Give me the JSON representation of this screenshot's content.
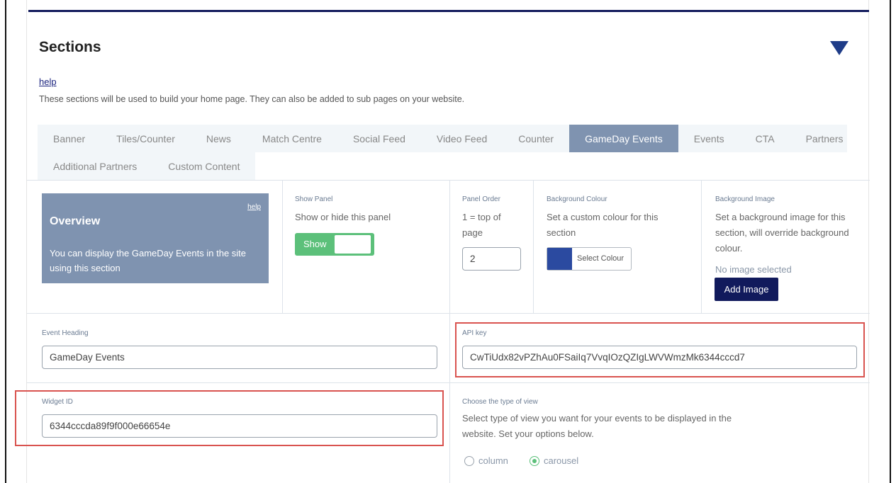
{
  "section": {
    "title": "Sections",
    "help_link": "help",
    "description": "These sections will be used to build your home page. They can also be added to sub pages on your website."
  },
  "tabs": {
    "row1": [
      "Banner",
      "Tiles/Counter",
      "News",
      "Match Centre",
      "Social Feed",
      "Video Feed",
      "Counter",
      "GameDay Events",
      "Events",
      "CTA",
      "Partners"
    ],
    "row2": [
      "Additional Partners",
      "Custom Content"
    ],
    "active": "GameDay Events"
  },
  "overview": {
    "help": "help",
    "title": "Overview",
    "text": "You can display the GameDay Events in the site using this section"
  },
  "show_panel": {
    "label": "Show Panel",
    "description": "Show or hide this panel",
    "toggle_label": "Show",
    "state": "on"
  },
  "panel_order": {
    "label": "Panel Order",
    "description": "1 = top of page",
    "value": "2"
  },
  "background_colour": {
    "label": "Background Colour",
    "description": "Set a custom colour for this section",
    "button": "Select Colour",
    "swatch_color": "#2b4aa0"
  },
  "background_image": {
    "label": "Background Image",
    "description": "Set a background image for this section, will override background colour.",
    "status": "No image selected",
    "button": "Add Image"
  },
  "event_heading": {
    "label": "Event Heading",
    "value": "GameDay Events"
  },
  "api_key": {
    "label": "API key",
    "value": "CwTiUdx82vPZhAu0FSaiIq7VvqIOzQZIgLWVWmzMk6344cccd7"
  },
  "widget_id": {
    "label": "Widget ID",
    "value": "6344cccda89f9f000e66654e"
  },
  "view_type": {
    "label": "Choose the type of view",
    "description": "Select type of view you want for your events to be displayed in the website. Set your options below.",
    "options": [
      "column",
      "carousel"
    ],
    "selected": "carousel"
  },
  "colors": {
    "accent_navy": "#111a5c",
    "tab_active": "#7f93b0",
    "toggle_green": "#5cc07a",
    "highlight_red": "#d9534f"
  }
}
